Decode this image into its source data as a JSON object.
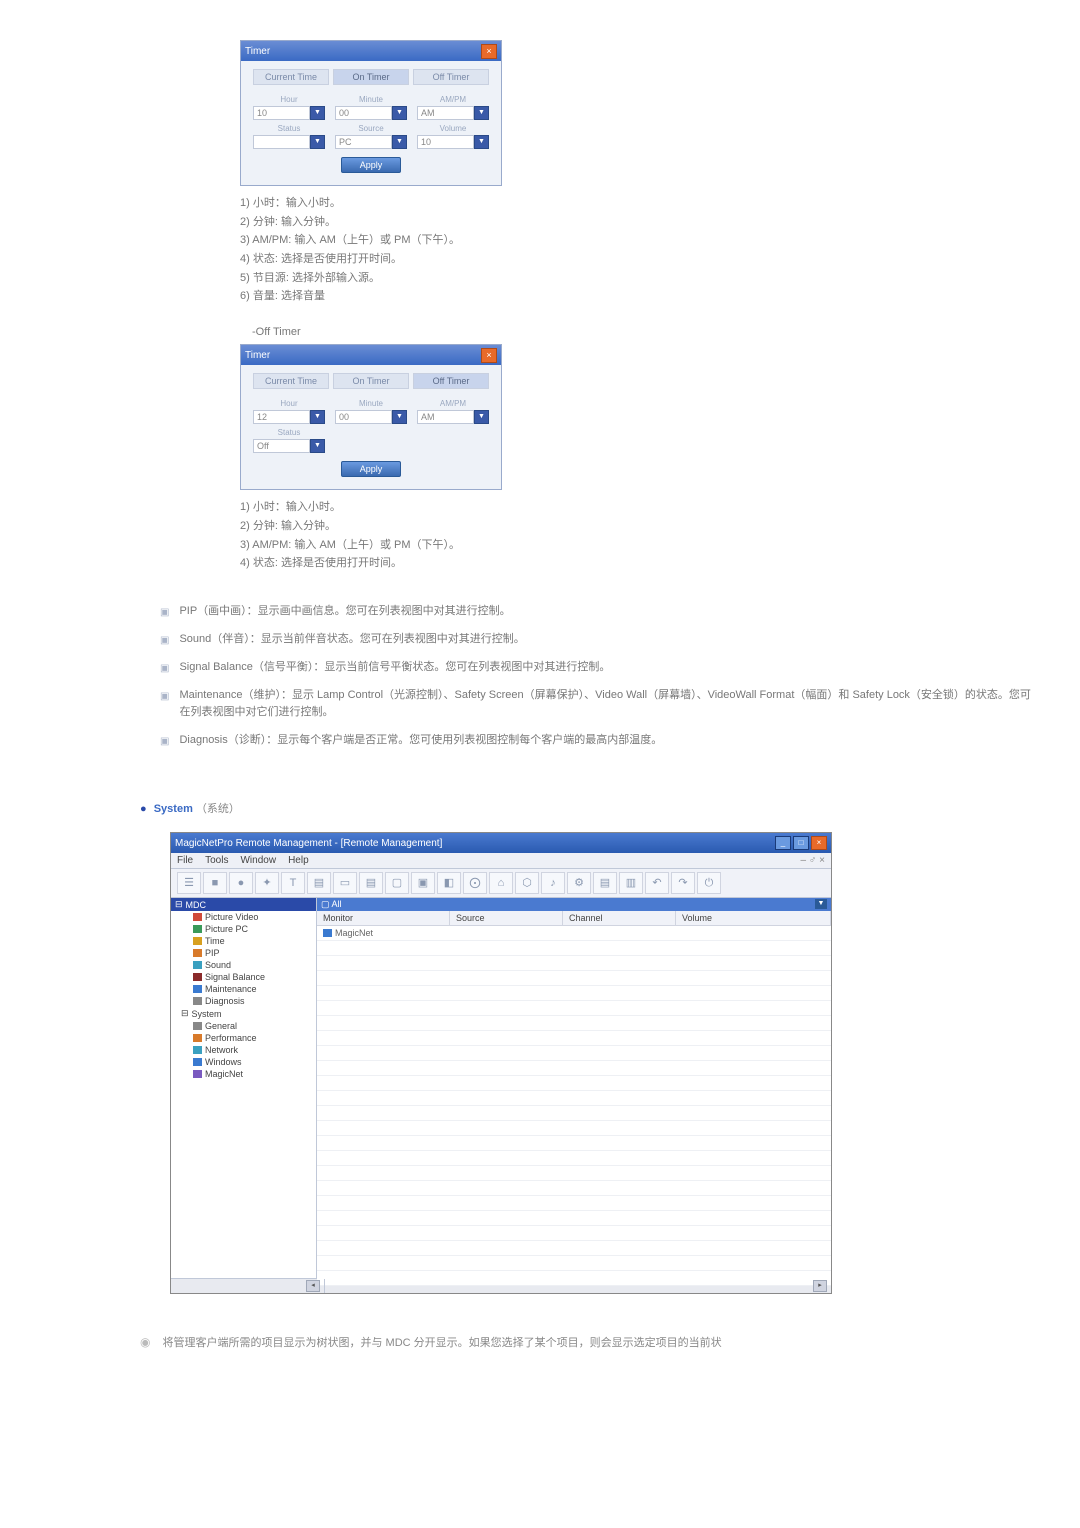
{
  "onTimerDialog": {
    "title": "Timer",
    "tabs": [
      "Current Time",
      "On Timer",
      "Off Timer"
    ],
    "activeTab": 1,
    "fields": [
      {
        "label": "Hour",
        "value": "10"
      },
      {
        "label": "Minute",
        "value": "00"
      },
      {
        "label": "AM/PM",
        "value": "AM"
      }
    ],
    "fieldsRow2": [
      {
        "label": "Status",
        "value": ""
      },
      {
        "label": "Source",
        "value": "PC"
      },
      {
        "label": "Volume",
        "value": "10"
      }
    ],
    "applyLabel": "Apply"
  },
  "onTimerList": [
    "1) 小时：输入小时。",
    "2) 分钟: 输入分钟。",
    "3) AM/PM: 输入 AM（上午）或 PM（下午）。",
    "4) 状态: 选择是否使用打开时间。",
    "5) 节目源: 选择外部输入源。",
    "6) 音量: 选择音量"
  ],
  "offTimerLabel": "-Off Timer",
  "offTimerDialog": {
    "title": "Timer",
    "tabs": [
      "Current Time",
      "On Timer",
      "Off Timer"
    ],
    "activeTab": 2,
    "fields": [
      {
        "label": "Hour",
        "value": "12"
      },
      {
        "label": "Minute",
        "value": "00"
      },
      {
        "label": "AM/PM",
        "value": "AM"
      }
    ],
    "fieldsRow2": [
      {
        "label": "Status",
        "value": "Off"
      }
    ],
    "applyLabel": "Apply"
  },
  "offTimerList": [
    "1) 小时：输入小时。",
    "2) 分钟: 输入分钟。",
    "3) AM/PM: 输入 AM（上午）或 PM（下午）。",
    "4) 状态: 选择是否使用打开时间。"
  ],
  "features": [
    "PIP（画中画）：显示画中画信息。您可在列表视图中对其进行控制。",
    "Sound（伴音）：显示当前伴音状态。您可在列表视图中对其进行控制。",
    "Signal Balance（信号平衡）：显示当前信号平衡状态。您可在列表视图中对其进行控制。",
    "Maintenance（维护）：显示 Lamp Control（光源控制）、Safety Screen（屏幕保护）、Video Wall（屏幕墙）、VideoWall Format（幅面）和 Safety Lock（安全锁）的状态。您可在列表视图中对它们进行控制。",
    "Diagnosis（诊断）：显示每个客户端是否正常。您可使用列表视图控制每个客户端的最高内部温度。"
  ],
  "sectionHead": {
    "main": "System",
    "sub": "（系统）"
  },
  "appWindow": {
    "title": "MagicNetPro Remote Management - [Remote Management]",
    "menus": [
      "File",
      "Tools",
      "Window",
      "Help"
    ],
    "menuRight": "– ♂ ×",
    "treeRoot": "MDC",
    "tree": [
      {
        "label": "Picture Video",
        "ico": "ico-red"
      },
      {
        "label": "Picture PC",
        "ico": "ico-green"
      },
      {
        "label": "Time",
        "ico": "ico-yellow"
      },
      {
        "label": "PIP",
        "ico": "ico-orange"
      },
      {
        "label": "Sound",
        "ico": "ico-cyan"
      },
      {
        "label": "Signal Balance",
        "ico": "ico-darkred"
      },
      {
        "label": "Maintenance",
        "ico": "ico-blue"
      },
      {
        "label": "Diagnosis",
        "ico": "ico-gray"
      }
    ],
    "tree2Root": "System",
    "tree2": [
      {
        "label": "General",
        "ico": "ico-gray"
      },
      {
        "label": "Performance",
        "ico": "ico-orange"
      },
      {
        "label": "Network",
        "ico": "ico-cyan"
      },
      {
        "label": "Windows",
        "ico": "ico-blue"
      },
      {
        "label": "MagicNet",
        "ico": "ico-purple"
      }
    ],
    "listHeader": "All",
    "columns": [
      "Monitor",
      "Source",
      "Channel",
      "Volume"
    ],
    "rowLabel": "MagicNet"
  },
  "footerDesc": "将管理客户端所需的项目显示为树状图，并与 MDC 分开显示。如果您选择了某个项目，则会显示选定项目的当前状"
}
